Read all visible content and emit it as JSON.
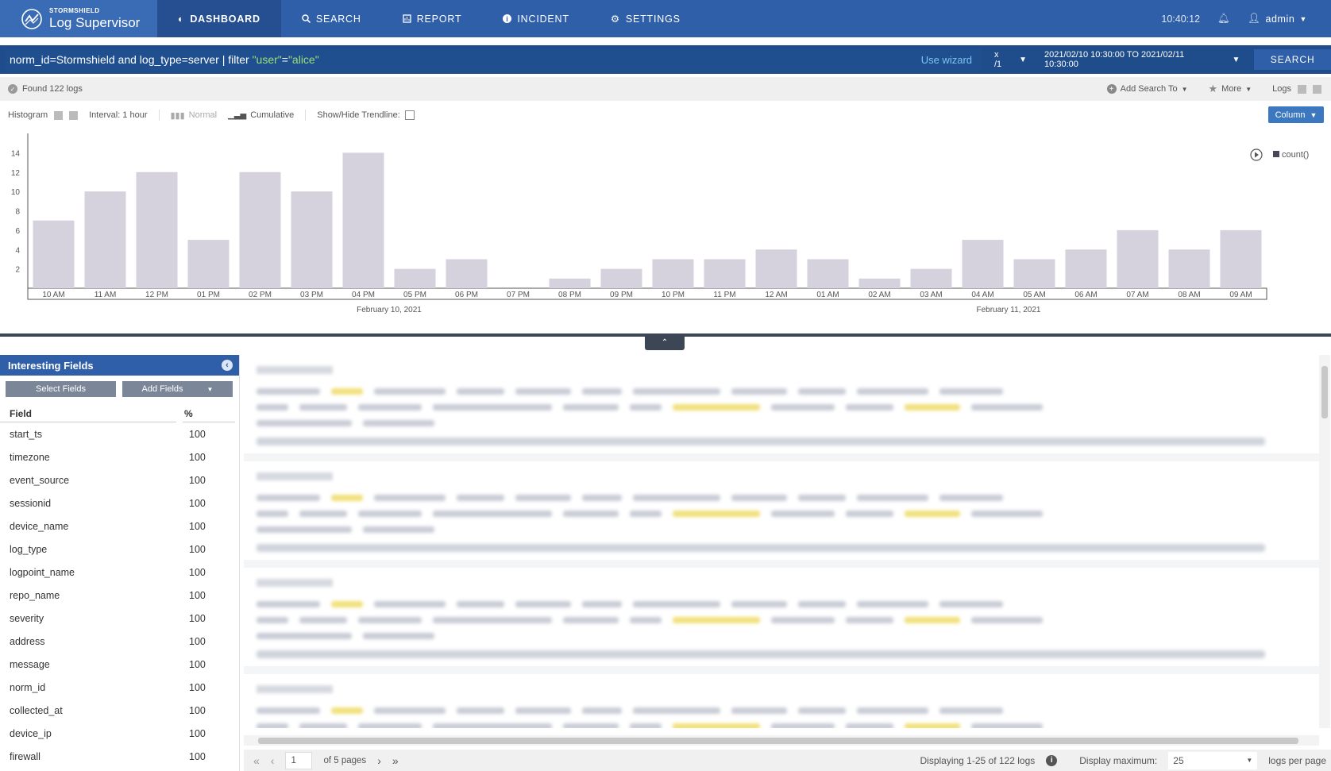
{
  "app": {
    "brand": "STORMSHIELD",
    "product": "Log Supervisor"
  },
  "nav": {
    "tabs": [
      {
        "label": "DASHBOARD",
        "icon": "dashboard-icon",
        "active": true
      },
      {
        "label": "SEARCH",
        "icon": "search-icon",
        "active": false
      },
      {
        "label": "REPORT",
        "icon": "report-icon",
        "active": false
      },
      {
        "label": "INCIDENT",
        "icon": "info-icon",
        "active": false
      },
      {
        "label": "SETTINGS",
        "icon": "gear-icon",
        "active": false
      }
    ],
    "clock": "10:40:12",
    "user": "admin"
  },
  "query": {
    "part1": "norm_id=Stormshield and log_type=server | filter ",
    "part2": "\"user\"",
    "part3": "=",
    "part4": "\"alice\"",
    "wizard": "Use wizard",
    "split": "x /1",
    "range": "2021/02/10 10:30:00 TO 2021/02/11 10:30:00",
    "search_label": "SEARCH"
  },
  "status": {
    "found": "Found 122 logs",
    "add_search": "Add Search To",
    "more": "More",
    "logs": "Logs"
  },
  "chart_tools": {
    "histogram": "Histogram",
    "interval": "Interval: 1 hour",
    "normal": "Normal",
    "cumulative": "Cumulative",
    "trendline": "Show/Hide Trendline:",
    "column": "Column"
  },
  "chart_data": {
    "type": "bar",
    "categories": [
      "10 AM",
      "11 AM",
      "12 PM",
      "01 PM",
      "02 PM",
      "03 PM",
      "04 PM",
      "05 PM",
      "06 PM",
      "07 PM",
      "08 PM",
      "09 PM",
      "10 PM",
      "11 PM",
      "12 AM",
      "01 AM",
      "02 AM",
      "03 AM",
      "04 AM",
      "05 AM",
      "06 AM",
      "07 AM",
      "08 AM",
      "09 AM"
    ],
    "series": [
      {
        "name": "count()",
        "values": [
          7,
          10,
          12,
          5,
          12,
          10,
          14,
          2,
          3,
          0,
          1,
          2,
          3,
          3,
          4,
          3,
          1,
          2,
          5,
          3,
          4,
          6,
          4,
          6
        ]
      }
    ],
    "yticks": [
      2,
      4,
      6,
      8,
      10,
      12,
      14
    ],
    "ylim": [
      0,
      16
    ],
    "date_labels": [
      {
        "label": "February 10, 2021",
        "index": 6.5
      },
      {
        "label": "February 11, 2021",
        "index": 18.5
      }
    ],
    "legend_position": "top-right",
    "color": "#d5d2de"
  },
  "fields": {
    "title": "Interesting Fields",
    "select_label": "Select Fields",
    "add_label": "Add Fields",
    "col_field": "Field",
    "col_pct": "%",
    "rows": [
      {
        "name": "start_ts",
        "pct": "100"
      },
      {
        "name": "timezone",
        "pct": "100"
      },
      {
        "name": "event_source",
        "pct": "100"
      },
      {
        "name": "sessionid",
        "pct": "100"
      },
      {
        "name": "device_name",
        "pct": "100"
      },
      {
        "name": "log_type",
        "pct": "100"
      },
      {
        "name": "logpoint_name",
        "pct": "100"
      },
      {
        "name": "repo_name",
        "pct": "100"
      },
      {
        "name": "severity",
        "pct": "100"
      },
      {
        "name": "address",
        "pct": "100"
      },
      {
        "name": "message",
        "pct": "100"
      },
      {
        "name": "norm_id",
        "pct": "100"
      },
      {
        "name": "collected_at",
        "pct": "100"
      },
      {
        "name": "device_ip",
        "pct": "100"
      },
      {
        "name": "firewall",
        "pct": "100"
      }
    ]
  },
  "pager": {
    "page": "1",
    "of_pages": "of 5 pages",
    "displaying": "Displaying 1-25 of 122 logs",
    "max_label": "Display maximum:",
    "max_value": "25",
    "per_page": "logs per page"
  }
}
